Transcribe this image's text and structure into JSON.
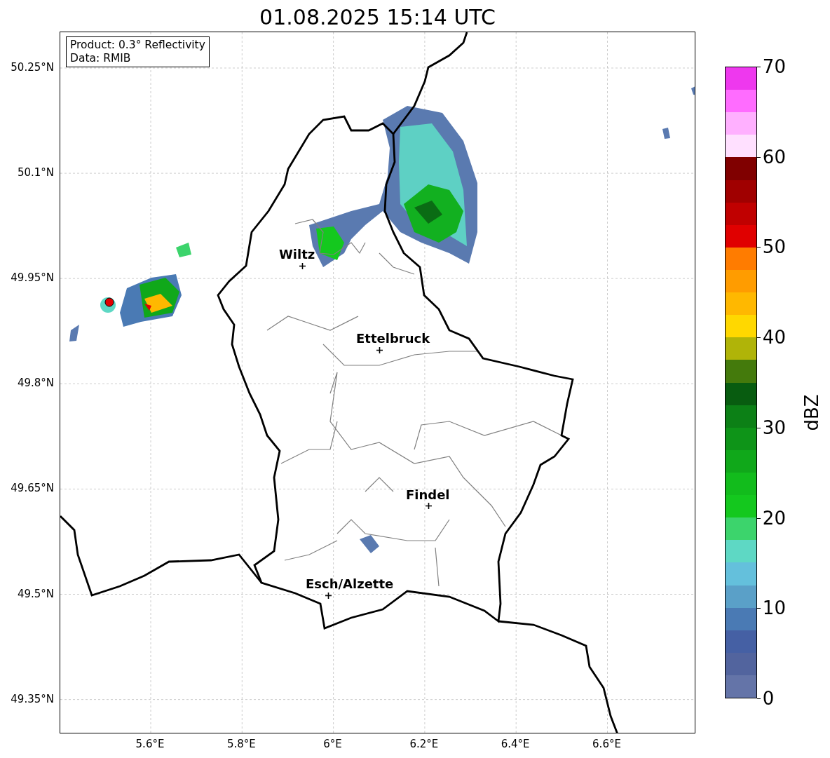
{
  "title": "01.08.2025 15:14 UTC",
  "info": {
    "lines": [
      "Product: 0.3° Reflectivity",
      "Data: RMIB"
    ]
  },
  "map": {
    "cities": [
      {
        "name": "Wiltz"
      },
      {
        "name": "Ettelbruck"
      },
      {
        "name": "Findel"
      },
      {
        "name": "Esch/Alzette"
      }
    ],
    "xticks": [
      "5.6°E",
      "5.8°E",
      "6°E",
      "6.2°E",
      "6.4°E",
      "6.6°E"
    ],
    "yticks": [
      "50.25°N",
      "50.1°N",
      "49.95°N",
      "49.8°N",
      "49.65°N",
      "49.5°N",
      "49.35°N"
    ]
  },
  "colorbar": {
    "label": "dBZ",
    "ticks": [
      "70",
      "60",
      "50",
      "40",
      "30",
      "20",
      "10",
      "0"
    ],
    "bands": [
      {
        "color": "#ee38ee"
      },
      {
        "color": "#ff6cff"
      },
      {
        "color": "#ffb0ff"
      },
      {
        "color": "#ffe0ff"
      },
      {
        "color": "#800000"
      },
      {
        "color": "#a00000"
      },
      {
        "color": "#c00000"
      },
      {
        "color": "#e00000"
      },
      {
        "color": "#ff7c00"
      },
      {
        "color": "#ff9c00"
      },
      {
        "color": "#ffb800"
      },
      {
        "color": "#ffd800"
      },
      {
        "color": "#b0b408"
      },
      {
        "color": "#447a0c"
      },
      {
        "color": "#085c10"
      },
      {
        "color": "#0c8016"
      },
      {
        "color": "#0e9418"
      },
      {
        "color": "#10a81a"
      },
      {
        "color": "#12bc1c"
      },
      {
        "color": "#14c81e"
      },
      {
        "color": "#3cd46c"
      },
      {
        "color": "#5ed8c4"
      },
      {
        "color": "#64c0dc"
      },
      {
        "color": "#5aa0c8"
      },
      {
        "color": "#4a7ab4"
      },
      {
        "color": "#4560a4"
      },
      {
        "color": "#52649e"
      },
      {
        "color": "#6474a8"
      }
    ]
  }
}
